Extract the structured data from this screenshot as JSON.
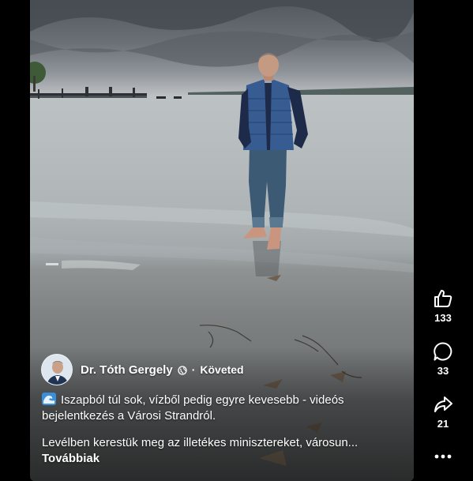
{
  "post": {
    "author_name": "Dr. Tóth Gergely",
    "separator": "·",
    "follow_status": "Követed",
    "caption_line1": "Iszapból túl sok, vízből pedig egyre kevesebb - videós bejelentkezés a Városi Strandról.",
    "caption_line2": "Levélben kerestük meg az illetékes minisztereket, városun...",
    "more_label": "Továbbiak"
  },
  "actions": {
    "likes": "133",
    "comments": "33",
    "shares": "21"
  },
  "icons": {
    "like": "thumbs-up-icon",
    "comment": "comment-bubble-icon",
    "share": "share-arrow-icon",
    "more": "more-dots-icon",
    "privacy": "globe-icon",
    "emoji": "wave-icon"
  },
  "colors": {
    "background": "#000000",
    "text": "#ffffff"
  }
}
